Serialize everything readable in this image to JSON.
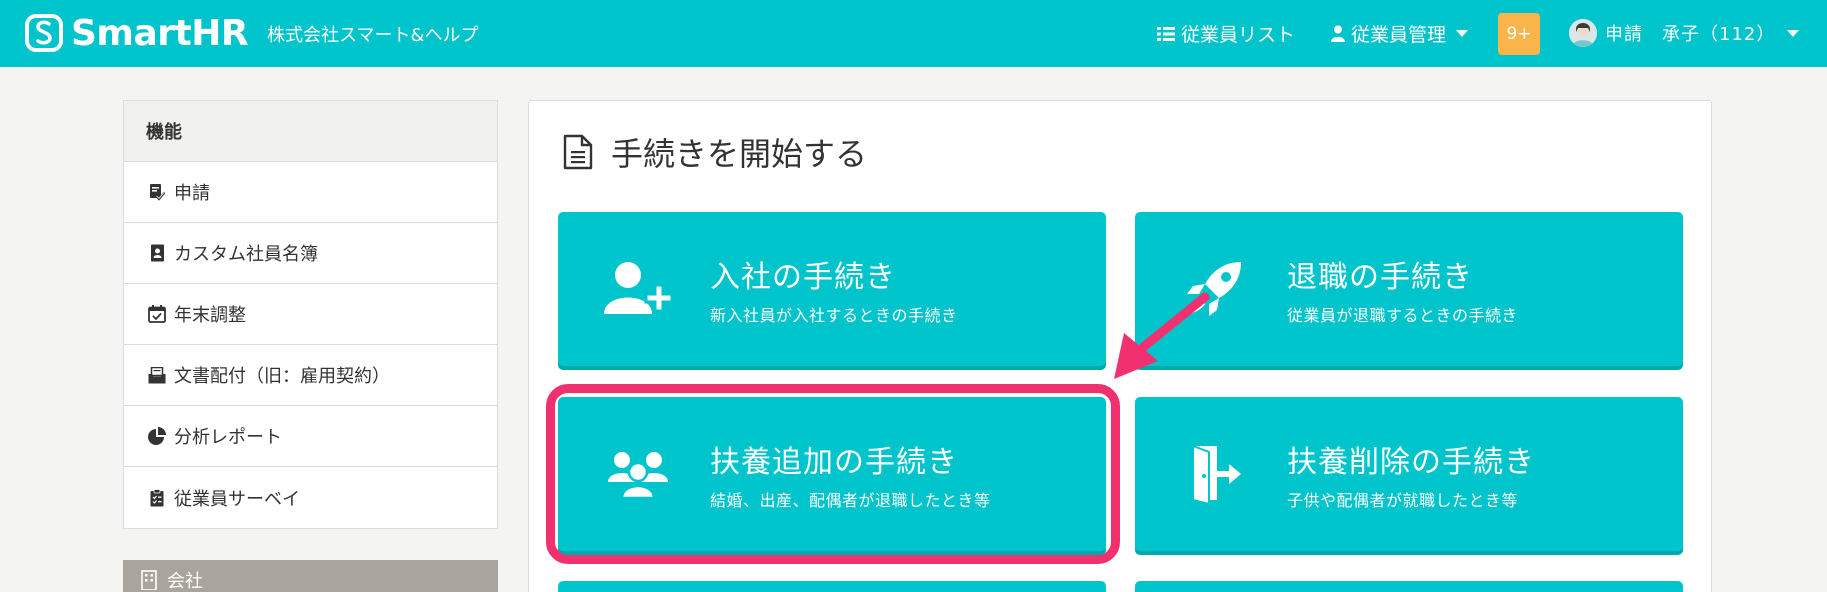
{
  "header": {
    "logo_text": "SmartHR",
    "company": "株式会社スマート&ヘルプ",
    "nav_employee_list": "従業員リスト",
    "nav_employee_manage": "従業員管理",
    "notification_count": "9+",
    "user_name": "申請　承子（112）"
  },
  "sidebar": {
    "title": "機能",
    "items": [
      {
        "label": "申請",
        "icon": "clipboard-check-icon"
      },
      {
        "label": "カスタム社員名簿",
        "icon": "id-card-icon"
      },
      {
        "label": "年末調整",
        "icon": "calendar-check-icon"
      },
      {
        "label": "文書配付（旧：雇用契約）",
        "icon": "inbox-icon"
      },
      {
        "label": "分析レポート",
        "icon": "pie-chart-icon"
      },
      {
        "label": "従業員サーベイ",
        "icon": "survey-clipboard-icon"
      }
    ],
    "section2_title": "会社"
  },
  "main": {
    "title": "手続きを開始する",
    "cards": [
      {
        "title": "入社の手続き",
        "subtitle": "新入社員が入社するときの手続き",
        "icon": "user-plus-icon"
      },
      {
        "title": "退職の手続き",
        "subtitle": "従業員が退職するときの手続き",
        "icon": "rocket-icon"
      },
      {
        "title": "扶養追加の手続き",
        "subtitle": "結婚、出産、配偶者が退職したとき等",
        "icon": "users-icon"
      },
      {
        "title": "扶養削除の手続き",
        "subtitle": "子供や配偶者が就職したとき等",
        "icon": "door-exit-icon"
      }
    ]
  },
  "colors": {
    "brand": "#00c4cc",
    "badge": "#f9b54b",
    "highlight": "#f1316f"
  }
}
